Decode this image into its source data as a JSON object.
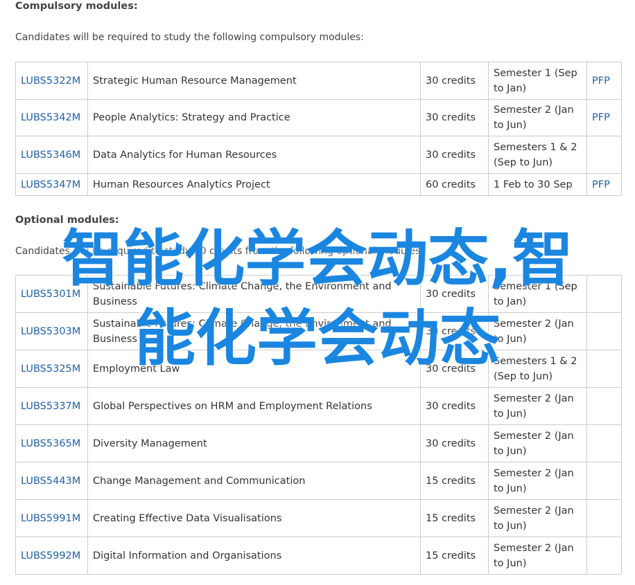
{
  "compulsory": {
    "heading": "Compulsory modules:",
    "intro": "Candidates will be required to study the following compulsory modules:",
    "rows": [
      {
        "code": "LUBS5322M",
        "title": "Strategic Human Resource Management",
        "credits": "30 credits",
        "semester": "Semester 1 (Sep to Jan)",
        "pfp": "PFP"
      },
      {
        "code": "LUBS5342M",
        "title": "People Analytics: Strategy and Practice",
        "credits": "30 credits",
        "semester": "Semester 2 (Jan to Jun)",
        "pfp": "PFP"
      },
      {
        "code": "LUBS5346M",
        "title": "Data Analytics for Human Resources",
        "credits": "30 credits",
        "semester": "Semesters 1 & 2 (Sep to Jun)",
        "pfp": ""
      },
      {
        "code": "LUBS5347M",
        "title": "Human Resources Analytics Project",
        "credits": "60 credits",
        "semester": "1 Feb to 30 Sep",
        "pfp": "PFP"
      }
    ]
  },
  "optional": {
    "heading": "Optional modules:",
    "intro": "Candidates will be required to study 30 credits from the following optional modules:",
    "rows": [
      {
        "code": "LUBS5301M",
        "title": "Sustainable Futures: Climate Change, the Environment and Business",
        "credits": "30 credits",
        "semester": "Semester 1 (Sep to Jan)",
        "pfp": ""
      },
      {
        "code": "LUBS5303M",
        "title": "Sustainable Futures: Climate Change, the Environment and Business",
        "credits": "30 credits",
        "semester": "Semester 2 (Jan to Jun)",
        "pfp": ""
      },
      {
        "code": "LUBS5325M",
        "title": "Employment Law",
        "credits": "30 credits",
        "semester": "Semesters 1 & 2 (Sep to Jun)",
        "pfp": ""
      },
      {
        "code": "LUBS5337M",
        "title": "Global Perspectives on HRM and Employment Relations",
        "credits": "30 credits",
        "semester": "Semester 2 (Jan to Jun)",
        "pfp": ""
      },
      {
        "code": "LUBS5365M",
        "title": "Diversity Management",
        "credits": "30 credits",
        "semester": "Semester 2 (Jan to Jun)",
        "pfp": ""
      },
      {
        "code": "LUBS5443M",
        "title": "Change Management and Communication",
        "credits": "15 credits",
        "semester": "Semester 2 (Jan to Jun)",
        "pfp": ""
      },
      {
        "code": "LUBS5991M",
        "title": "Creating Effective Data Visualisations",
        "credits": "15 credits",
        "semester": "Semester 2 (Jan to Jun)",
        "pfp": ""
      },
      {
        "code": "LUBS5992M",
        "title": "Digital Information and Organisations",
        "credits": "15 credits",
        "semester": "Semester 2 (Jan to Jun)",
        "pfp": ""
      }
    ]
  },
  "watermark": {
    "line1": "智能化学会动态,智",
    "line2": "能化学会动态",
    "color": "#1a86e0"
  },
  "colors": {
    "link": "#1f5fa8",
    "text": "#333333",
    "border": "#cccccc"
  }
}
